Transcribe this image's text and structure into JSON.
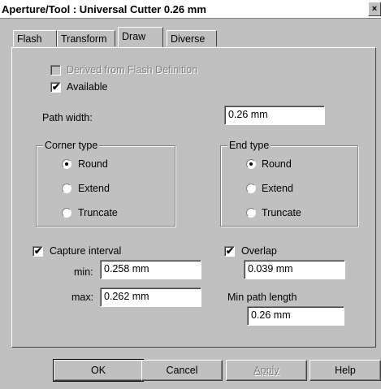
{
  "window": {
    "title": "Aperture/Tool : Universal Cutter 0.26 mm",
    "close_glyph": "×"
  },
  "tabs": [
    {
      "label": "Flash",
      "active": false
    },
    {
      "label": "Transform",
      "active": false
    },
    {
      "label": "Draw",
      "active": true
    },
    {
      "label": "Diverse",
      "active": false
    }
  ],
  "draw": {
    "derived_label": "Derived from Flash Definition",
    "derived_checked": false,
    "available_label": "Available",
    "available_checked": true,
    "path_width_label": "Path width:",
    "path_width_value": "0.26 mm",
    "corner_type": {
      "legend": "Corner type",
      "options": [
        "Round",
        "Extend",
        "Truncate"
      ],
      "selected": "Round"
    },
    "end_type": {
      "legend": "End type",
      "options": [
        "Round",
        "Extend",
        "Truncate"
      ],
      "selected": "Round"
    },
    "capture_interval_label": "Capture interval",
    "capture_interval_checked": true,
    "min_label": "min:",
    "min_value": "0.258 mm",
    "max_label": "max:",
    "max_value": "0.262 mm",
    "overlap_label": "Overlap",
    "overlap_checked": true,
    "overlap_value": "0.039 mm",
    "min_path_length_label": "Min path length",
    "min_path_length_value": "0.26 mm"
  },
  "buttons": {
    "ok": "OK",
    "cancel": "Cancel",
    "apply": "Apply",
    "help": "Help"
  },
  "check_glyph": "✔"
}
